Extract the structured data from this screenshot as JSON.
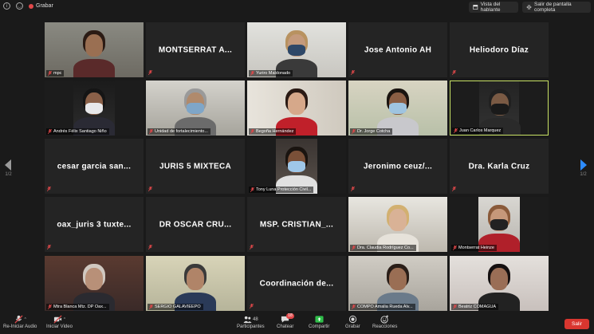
{
  "topbar": {
    "recording_label": "Grabar",
    "speaker_view_label": "Vista del hablante",
    "exit_fullscreen_label": "Salir de pantalla completa"
  },
  "pagination": {
    "left": "1/2",
    "right": "1/2"
  },
  "tiles": [
    {
      "type": "video",
      "label": "mpc"
    },
    {
      "type": "name",
      "display": "MONTSERRAT  A..."
    },
    {
      "type": "video",
      "label": "Yuriro Maldonado"
    },
    {
      "type": "name",
      "display": "Jose Antonio AH"
    },
    {
      "type": "name",
      "display": "Heliodoro Díaz"
    },
    {
      "type": "video",
      "label": "Andrés Félix Santiago Niño"
    },
    {
      "type": "video",
      "label": "Unidad de fortalecimiento..."
    },
    {
      "type": "video",
      "label": "Begoña Hernández"
    },
    {
      "type": "video",
      "label": "Dr. Jorge Cotcha"
    },
    {
      "type": "video",
      "label": "Juan Carlos Marquez",
      "active": true
    },
    {
      "type": "name",
      "display": "cesar garcia san..."
    },
    {
      "type": "name",
      "display": "JURIS 5 MIXTECA"
    },
    {
      "type": "video",
      "label": "Tony Luna Protección Civil..."
    },
    {
      "type": "name",
      "display": "Jeronimo  ceuz/..."
    },
    {
      "type": "name",
      "display": "Dra. Karla Cruz"
    },
    {
      "type": "name",
      "display": "oax_juris 3 tuxte..."
    },
    {
      "type": "name",
      "display": "DR OSCAR CRU..."
    },
    {
      "type": "name",
      "display": "MSP.  CRISTIAN_..."
    },
    {
      "type": "video",
      "label": "Dra. Claudia Rodríguez Co..."
    },
    {
      "type": "video",
      "label": "Montserrat Heinze"
    },
    {
      "type": "video",
      "label": "Mtra Blanca Mtz. DP Oax..."
    },
    {
      "type": "video",
      "label": "SERGIO GALAVIEEPO"
    },
    {
      "type": "name",
      "display": "Coordinación  de..."
    },
    {
      "type": "video",
      "label": "COMPO Amalia Rueda Alv..."
    },
    {
      "type": "video",
      "label": "Beatriz COMAGUA"
    }
  ],
  "toolbar": {
    "audio_label": "Re-Iniciar Audio",
    "video_label": "Iniciar Video",
    "participants_label": "Participantes",
    "participants_count": "48",
    "chat_label": "Chatear",
    "chat_badge": "18",
    "share_label": "Compartir",
    "record_label": "Grabar",
    "reactions_label": "Reacciones",
    "leave_label": "Salir"
  },
  "colors": {
    "background": "#1a1a1a",
    "tile": "#242424",
    "active_border": "#c9e265",
    "share_green": "#2fbf4a",
    "leave_red": "#d9362f",
    "nav_blue": "#2d8cff"
  }
}
